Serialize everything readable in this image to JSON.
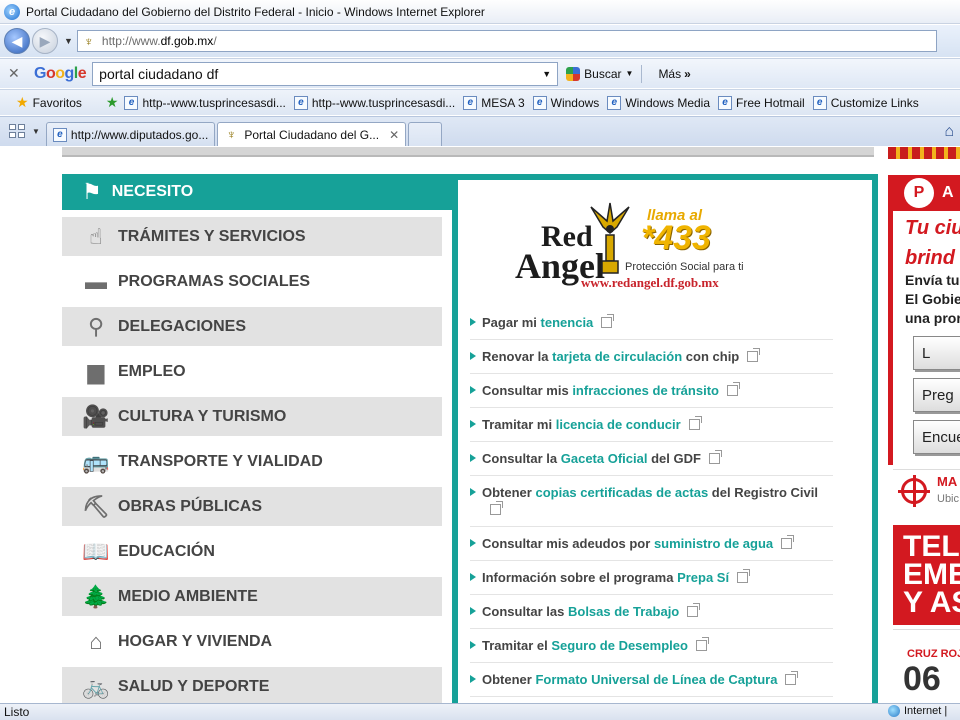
{
  "window": {
    "title": "Portal Ciudadano del Gobierno del Distrito Federal - Inicio - Windows Internet Explorer"
  },
  "address": {
    "prefix": "http://www.",
    "domain": "df.gob.mx",
    "suffix": "/"
  },
  "google_toolbar": {
    "logo": [
      "G",
      "o",
      "o",
      "g",
      "l",
      "e"
    ],
    "query": "portal ciudadano df",
    "search_label": "Buscar",
    "more_label": "Más"
  },
  "favorites": {
    "label": "Favoritos",
    "items": [
      "http--www.tusprincesasdi...",
      "http--www.tusprincesasdi...",
      "MESA 3",
      "Windows",
      "Windows Media",
      "Free Hotmail",
      "Customize Links"
    ]
  },
  "tabs": [
    {
      "label": "http://www.diputados.go...",
      "active": false
    },
    {
      "label": "Portal Ciudadano del G...",
      "active": true
    }
  ],
  "sidebar": {
    "header": "NECESITO",
    "items": [
      {
        "label": "TRÁMITES Y SERVICIOS",
        "icon": "fingerprint-icon",
        "glyph": "☝"
      },
      {
        "label": "PROGRAMAS SOCIALES",
        "icon": "card-icon",
        "glyph": "▬"
      },
      {
        "label": "DELEGACIONES",
        "icon": "location-pin-icon",
        "glyph": "⚲"
      },
      {
        "label": "EMPLEO",
        "icon": "briefcase-icon",
        "glyph": "▆"
      },
      {
        "label": "CULTURA Y TURISMO",
        "icon": "camera-icon",
        "glyph": "🎥"
      },
      {
        "label": "TRANSPORTE Y VIALIDAD",
        "icon": "bus-icon",
        "glyph": "🚌"
      },
      {
        "label": "OBRAS PÚBLICAS",
        "icon": "worker-icon",
        "glyph": "⛏"
      },
      {
        "label": "EDUCACIÓN",
        "icon": "book-icon",
        "glyph": "📖"
      },
      {
        "label": "MEDIO AMBIENTE",
        "icon": "trees-icon",
        "glyph": "🌲"
      },
      {
        "label": "HOGAR Y VIVIENDA",
        "icon": "house-icon",
        "glyph": "⌂"
      },
      {
        "label": "SALUD Y DEPORTE",
        "icon": "bicycle-icon",
        "glyph": "🚲"
      }
    ]
  },
  "banner": {
    "red": "Red",
    "angel": "Angel",
    "llama": "llama al",
    "number": "*433",
    "tagline": "Protección Social para ti",
    "url": "www.redangel.df.gob.mx"
  },
  "services": [
    {
      "pre": "Pagar mi",
      "link": "tenencia",
      "post": ""
    },
    {
      "pre": "Renovar la",
      "link": "tarjeta de circulación",
      "post": "con chip"
    },
    {
      "pre": "Consultar mis",
      "link": "infracciones de tránsito",
      "post": ""
    },
    {
      "pre": "Tramitar mi",
      "link": "licencia de conducir",
      "post": ""
    },
    {
      "pre": "Consultar la",
      "link": "Gaceta Oficial",
      "post": "del GDF"
    },
    {
      "pre": "Obtener",
      "link": "copias certificadas de actas",
      "post": "del Registro Civil"
    },
    {
      "pre": "Consultar mis adeudos por",
      "link": "suministro de agua",
      "post": ""
    },
    {
      "pre": "Información sobre el programa",
      "link": "Prepa Sí",
      "post": ""
    },
    {
      "pre": "Consultar las",
      "link": "Bolsas de Trabajo",
      "post": ""
    },
    {
      "pre": "Tramitar el",
      "link": "Seguro de Desempleo",
      "post": ""
    },
    {
      "pre": "Obtener",
      "link": "Formato Universal de Línea de Captura",
      "post": ""
    }
  ],
  "right_panel": {
    "badge": "P",
    "title": "A",
    "tu_line1": "Tu ciu",
    "tu_line2": "brind",
    "env_line1": "Envía tu",
    "env_line2": "El Gobie",
    "env_line3": "una pror",
    "buttons": [
      "L",
      "Preg",
      "Encue"
    ],
    "ma_title": "MA",
    "ma_sub": "Ubic",
    "tel_line1": "TELÉ",
    "tel_line2": "EME",
    "tel_line3": "Y AS",
    "cruz": "CRUZ ROJ",
    "cruz_num": "06"
  },
  "status": {
    "text": "Listo",
    "zone": "Internet |"
  }
}
